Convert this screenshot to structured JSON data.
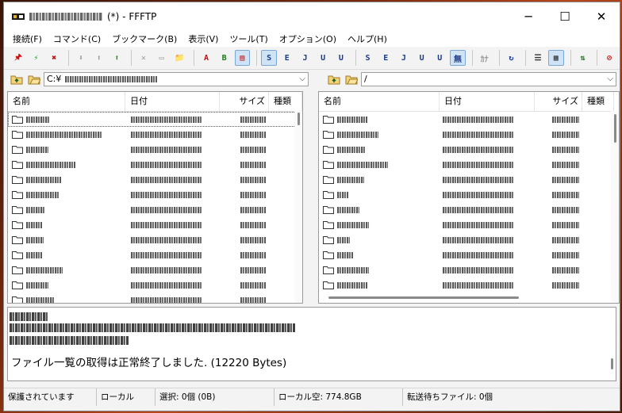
{
  "window": {
    "title": "(*) - FFFTP",
    "minimize": "─",
    "maximize": "☐",
    "close": "✕"
  },
  "menu": [
    "接続(F)",
    "コマンド(C)",
    "ブックマーク(B)",
    "表示(V)",
    "ツール(T)",
    "オプション(O)",
    "ヘルプ(H)"
  ],
  "toolbar": [
    {
      "name": "connect-icon",
      "glyph": "🖈",
      "color": "#d0101a"
    },
    {
      "name": "quick-connect-icon",
      "glyph": "⚡",
      "color": "#2a9a2a"
    },
    {
      "name": "disconnect-icon",
      "glyph": "✖",
      "color": "#c01010"
    },
    {
      "sep": true
    },
    {
      "name": "download-icon",
      "glyph": "⬇",
      "color": "#9a9a9a"
    },
    {
      "name": "upload-icon",
      "glyph": "⬆",
      "color": "#9a9a9a"
    },
    {
      "name": "mirror-upload-icon",
      "glyph": "⬆",
      "color": "#1c9a1c"
    },
    {
      "sep": true
    },
    {
      "name": "delete-icon",
      "glyph": "✕",
      "color": "#9a9a9a"
    },
    {
      "name": "rename-icon",
      "glyph": "▭",
      "color": "#9a9a9a"
    },
    {
      "name": "mkdir-icon",
      "glyph": "📁",
      "color": "#c89a2a"
    },
    {
      "sep": true
    },
    {
      "name": "ascii-mode-icon",
      "glyph": "A",
      "color": "#c01010"
    },
    {
      "name": "binary-mode-icon",
      "glyph": "B",
      "color": "#1a7a1a"
    },
    {
      "name": "auto-mode-icon",
      "glyph": "▤",
      "color": "#c01010",
      "on": true
    },
    {
      "sep": true
    },
    {
      "name": "kanji-sjis-icon",
      "glyph": "S",
      "color": "#1a3a8a",
      "on": true
    },
    {
      "name": "kanji-euc-icon",
      "glyph": "E",
      "color": "#1a3a8a"
    },
    {
      "name": "kanji-jis-icon",
      "glyph": "J",
      "color": "#1a3a8a"
    },
    {
      "name": "kanji-utf8n-icon",
      "glyph": "U",
      "color": "#1a3a8a"
    },
    {
      "name": "kanji-utf8bom-icon",
      "glyph": "U",
      "color": "#1a3a8a"
    },
    {
      "sep": true
    },
    {
      "name": "remote-sjis-icon",
      "glyph": "S",
      "color": "#1a3a8a"
    },
    {
      "name": "remote-euc-icon",
      "glyph": "E",
      "color": "#1a3a8a"
    },
    {
      "name": "remote-jis-icon",
      "glyph": "J",
      "color": "#1a3a8a"
    },
    {
      "name": "remote-utf8n-icon",
      "glyph": "U",
      "color": "#1a3a8a"
    },
    {
      "name": "remote-utf8bom-icon",
      "glyph": "U",
      "color": "#1a3a8a"
    },
    {
      "name": "no-convert-icon",
      "glyph": "無",
      "color": "#1a3a8a",
      "on": true
    },
    {
      "sep": true
    },
    {
      "name": "kana-convert-icon",
      "glyph": "ｶﾅ",
      "color": "#9a9a9a"
    },
    {
      "sep": true
    },
    {
      "name": "refresh-icon",
      "glyph": "↻",
      "color": "#1a3a9a"
    },
    {
      "sep": true
    },
    {
      "name": "list-view-icon",
      "glyph": "☰",
      "color": "#333"
    },
    {
      "name": "detail-view-icon",
      "glyph": "▦",
      "color": "#333",
      "on": true
    },
    {
      "sep": true
    },
    {
      "name": "sync-dir-icon",
      "glyph": "⇅",
      "color": "#1a7a1a"
    },
    {
      "sep": true
    },
    {
      "name": "stop-icon",
      "glyph": "⊘",
      "color": "#d01010"
    }
  ],
  "local": {
    "path": "C:¥",
    "columns": {
      "name": "名前",
      "date": "日付",
      "size": "サイズ",
      "type": "種類"
    },
    "row_count": 13
  },
  "remote": {
    "path": "/",
    "columns": {
      "name": "名前",
      "date": "日付",
      "size": "サイズ",
      "type": "種類"
    },
    "row_count": 12
  },
  "log": {
    "message": "ファイル一覧の取得は正常終了しました. (12220 Bytes)"
  },
  "status": {
    "security": "保護されています",
    "mode": "ローカル",
    "selected": "選択: 0個 (0B)",
    "free": "ローカル空: 774.8GB",
    "queue": "転送待ちファイル: 0個"
  }
}
